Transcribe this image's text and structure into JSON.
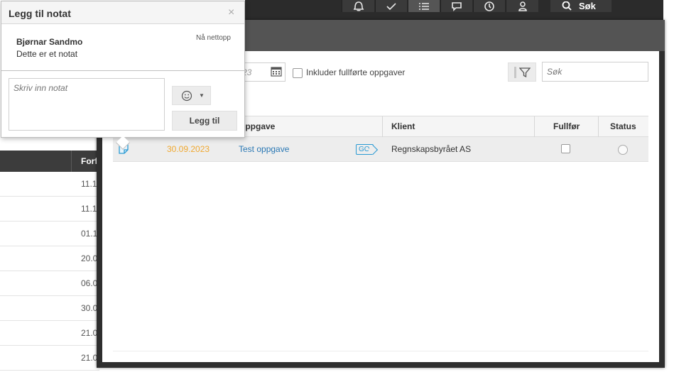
{
  "topbar": {
    "search_label": "Søk",
    "icons": [
      "bell-icon",
      "check-icon",
      "list-icon",
      "chat-icon",
      "clock-icon",
      "person-icon"
    ]
  },
  "background_table": {
    "header_partial": "Forf",
    "rows": [
      "11.1",
      "11.1",
      "01.1",
      "20.0",
      "06.0",
      "30.0",
      "21.0",
      "21.0"
    ]
  },
  "toolbar": {
    "date_partial": "23",
    "include_completed_label": "Inkluder fullførte oppgaver",
    "search_placeholder": "Søk"
  },
  "table": {
    "headers": {
      "task": "Oppgave",
      "client": "Klient",
      "complete": "Fullfør",
      "status": "Status"
    },
    "rows": [
      {
        "date": "30.09.2023",
        "task": "Test oppgave",
        "badge": "GO",
        "client": "Regnskapsbyrået AS"
      }
    ]
  },
  "note_popup": {
    "title": "Legg til notat",
    "close_glyph": "×",
    "note": {
      "author": "Bjørnar Sandmo",
      "time": "Nå nettopp",
      "text": "Dette er et notat"
    },
    "input_placeholder": "Skriv inn notat",
    "add_button": "Legg til"
  },
  "colors": {
    "date_accent": "#f0a830",
    "link": "#2a78b4",
    "go_badge": "#2a9ad3"
  }
}
